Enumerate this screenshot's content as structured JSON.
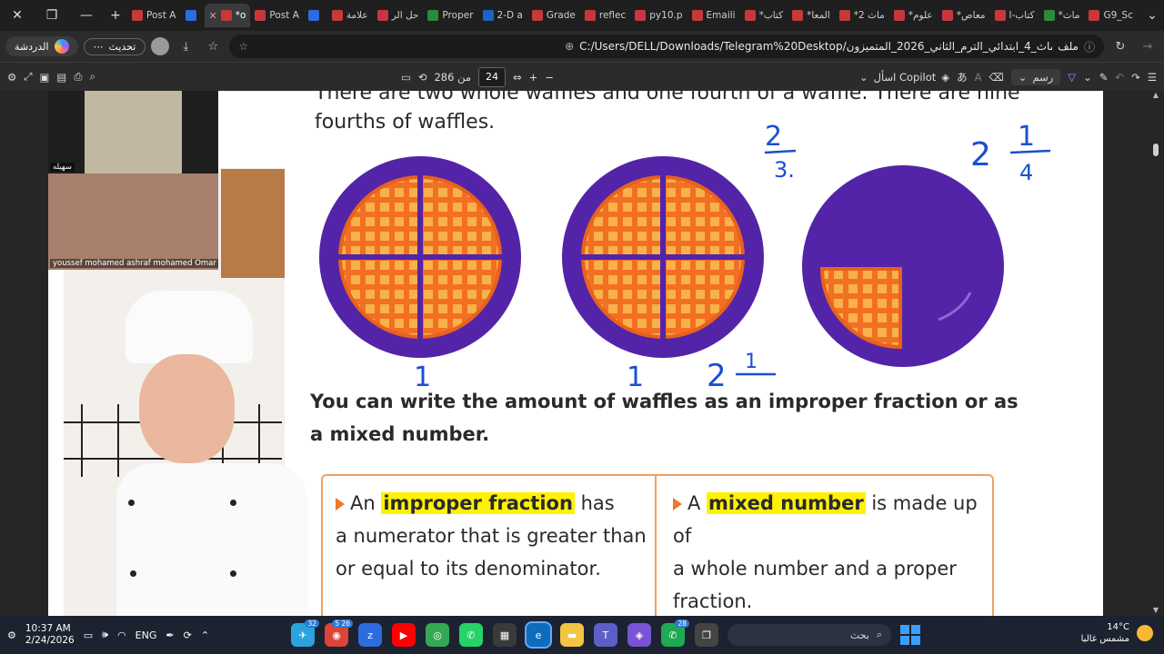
{
  "browser": {
    "tabs": [
      {
        "label": "Post A",
        "icon": "pdf"
      },
      {
        "label": "",
        "icon": "zm"
      },
      {
        "label": "*o",
        "icon": "pdf",
        "active": true
      },
      {
        "label": "Post A",
        "icon": "pdf"
      },
      {
        "label": "",
        "icon": "zm"
      },
      {
        "label": "علامة",
        "icon": "pdf"
      },
      {
        "label": "حل الر",
        "icon": "pdf"
      },
      {
        "label": "Proper",
        "icon": "grn"
      },
      {
        "label": "2-D a",
        "icon": "blu"
      },
      {
        "label": "Grade",
        "icon": "pdf"
      },
      {
        "label": "reflec",
        "icon": "pdf"
      },
      {
        "label": "py10.p",
        "icon": "pdf"
      },
      {
        "label": "Emaili",
        "icon": "pdf"
      },
      {
        "label": "*كتاب",
        "icon": "pdf"
      },
      {
        "label": "*المعا",
        "icon": "pdf"
      },
      {
        "label": "*ماث 2",
        "icon": "pdf"
      },
      {
        "label": "*علوم",
        "icon": "pdf"
      },
      {
        "label": "*معاص",
        "icon": "pdf"
      },
      {
        "label": "كتاب-ا",
        "icon": "pdf"
      },
      {
        "label": "*ماث",
        "icon": "grn"
      },
      {
        "label": "G9_Sc",
        "icon": "pdf"
      }
    ],
    "chat_label": "الدردشة",
    "update_label": "تحديث",
    "url_label": "ملف",
    "url": "C:/Users/DELL/Downloads/Telegram%20Desktop/ماث_4_ابتدائي_الترم_الثاني_2026_المتميزون.pdf"
  },
  "pdf_toolbar": {
    "page_current": "24",
    "page_total": "من 286",
    "copilot_label": "اسأل Copilot",
    "draw_label": "رسم"
  },
  "page": {
    "line1": "There are two whole waffles and one fourth of a waffle. There are nine",
    "line2": "fourths  of waffles.",
    "sentence1": "You can write the amount of waffles as an improper fraction or as",
    "sentence2": "a mixed number.",
    "left_def": {
      "pre": "An ",
      "term": "improper fraction",
      "post1": " has",
      "line2": "a numerator that is greater than",
      "line3": "or equal to its denominator."
    },
    "right_def": {
      "pre": "A ",
      "term": "mixed number",
      "post1": " is made up of",
      "line2": "a whole number and a proper",
      "line3": "fraction."
    },
    "handwriting": {
      "frac_top": "2",
      "frac_bottom": "3.",
      "mixed_whole": "2",
      "mixed_num": "1",
      "mixed_den": "4",
      "label1": "1",
      "label2": "1",
      "label3_whole": "2",
      "label3_num": "1"
    }
  },
  "video": {
    "tile1_name": "سهيله",
    "tile2_name": "youssef mohamed ashraf mohamed Omar"
  },
  "taskbar": {
    "time": "10:37 AM",
    "date": "2/24/2026",
    "lang": "ENG",
    "search_placeholder": "بحث",
    "temperature": "14°C",
    "weather_text": "مشمس غالبا",
    "badge_telegram": "32",
    "badge_chrome": "5 26",
    "badge_whatsapp2": "28"
  }
}
